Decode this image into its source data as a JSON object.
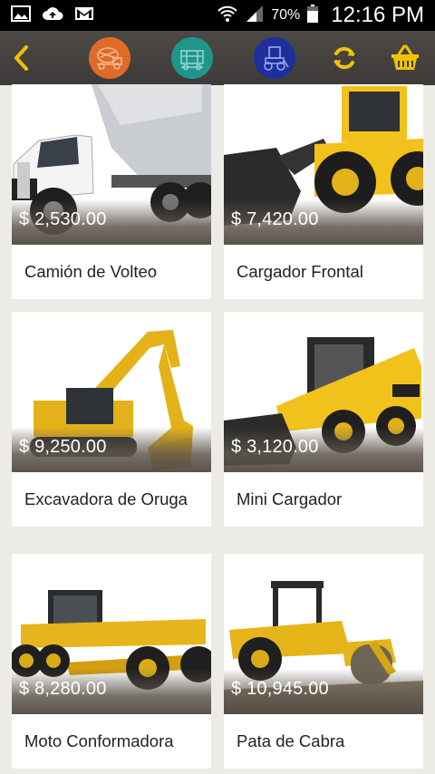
{
  "status_bar": {
    "battery_percent": "70%",
    "time": "12:16 PM",
    "icons": [
      "image-icon",
      "cloud-upload-icon",
      "gmail-icon",
      "wifi-icon",
      "signal-icon",
      "battery-icon"
    ]
  },
  "app_bar": {
    "back_icon": "chevron-left-icon",
    "categories": [
      {
        "icon": "concrete-mixer-icon",
        "color": "#e06a2a"
      },
      {
        "icon": "crane-icon",
        "color": "#20958a"
      },
      {
        "icon": "tractor-icon",
        "color": "#1d2f9c"
      }
    ],
    "refresh_icon": "refresh-icon",
    "cart_icon": "basket-icon",
    "accent_color": "#f2c200"
  },
  "products": [
    {
      "price": "$ 2,530.00",
      "name": "Camión de Volteo"
    },
    {
      "price": "$ 7,420.00",
      "name": "Cargador Frontal"
    },
    {
      "price": "$ 9,250.00",
      "name": "Excavadora de Oruga"
    },
    {
      "price": "$ 3,120.00",
      "name": "Mini Cargador"
    },
    {
      "price": "$ 8,280.00",
      "name": "Moto Conformadora"
    },
    {
      "price": "$ 10,945.00",
      "name": "Pata de Cabra"
    }
  ]
}
